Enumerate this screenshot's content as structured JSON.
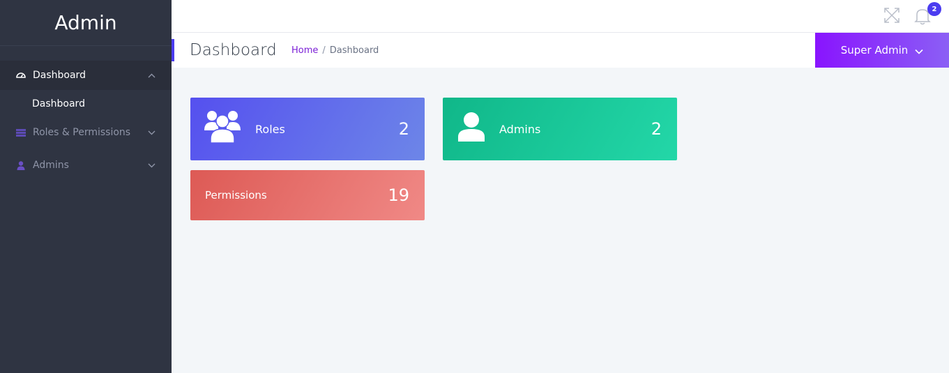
{
  "sidebar": {
    "brand": "Admin",
    "menu": [
      {
        "label": "Dashboard",
        "icon": "gauge-icon",
        "expanded": true,
        "children": [
          "Dashboard"
        ]
      },
      {
        "label": "Roles & Permissions",
        "icon": "table-icon",
        "expanded": false
      },
      {
        "label": "Admins",
        "icon": "user-icon",
        "expanded": false
      }
    ]
  },
  "topbar": {
    "fullscreen_icon": "expand-icon",
    "notifications_icon": "bell-icon",
    "notifications_count": "2"
  },
  "header": {
    "title": "Dashboard",
    "breadcrumb": {
      "home": "Home",
      "separator": "/",
      "current": "Dashboard"
    },
    "user_menu": {
      "label": "Super Admin",
      "icon": "chevron-down-icon"
    }
  },
  "cards": [
    {
      "label": "Roles",
      "value": "2",
      "icon": "users-icon",
      "color": "#5550ef"
    },
    {
      "label": "Admins",
      "value": "2",
      "icon": "user-icon",
      "color": "#10b789"
    },
    {
      "label": "Permissions",
      "value": "19",
      "color": "#dd5a55"
    }
  ],
  "colors": {
    "sidebar_bg": "#2f3442",
    "accent": "#4b3cf0",
    "user_button": "#8914fe",
    "breadcrumb_link": "#7b1fd6"
  }
}
